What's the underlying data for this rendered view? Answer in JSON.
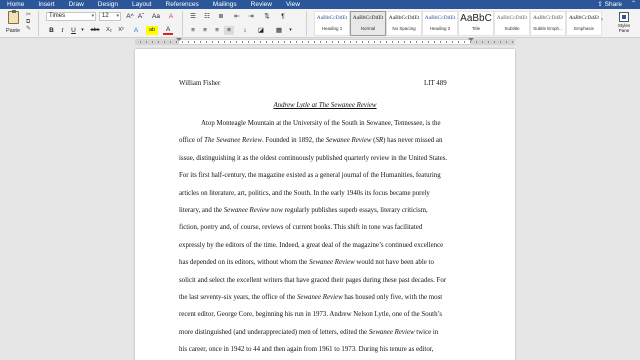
{
  "menu": {
    "tabs": [
      "Home",
      "Insert",
      "Draw",
      "Design",
      "Layout",
      "References",
      "Mailings",
      "Review",
      "View"
    ],
    "active_tab": "Home",
    "share_label": "Share",
    "caret_icon": "chevron-up-icon"
  },
  "ribbon": {
    "paste_label": "Paste",
    "font_name": "Times",
    "font_size": "12",
    "grow_font": "A^",
    "shrink_font": "Aˇ",
    "change_case": "Aa",
    "clear_format": "A",
    "bold": "B",
    "italic": "I",
    "underline": "U",
    "strike": "abc",
    "subscript": "X₂",
    "superscript": "X²",
    "text_effects": "A",
    "highlight": "ab",
    "font_color": "A",
    "pilcrow": "¶",
    "styles": [
      {
        "sample": "AaBbCcDdEt",
        "name": "Heading 1"
      },
      {
        "sample": "AaBbCcDdEt",
        "name": "Normal"
      },
      {
        "sample": "AaBbCcDdEt",
        "name": "No Spacing"
      },
      {
        "sample": "AaBbCcDdEt",
        "name": "Heading 2"
      },
      {
        "sample": "AaBbC",
        "name": "Title"
      },
      {
        "sample": "AaBbCcDdEt",
        "name": "Subtitle"
      },
      {
        "sample": "AaBbCcDdEt",
        "name": "Subtle Emph..."
      },
      {
        "sample": "AaBbCcDdEt",
        "name": "Emphasis"
      }
    ],
    "selected_style": "Normal",
    "styles_pane_label": "Styles\nPane",
    "colors": {
      "accent": "#2b579a",
      "highlight_color": "#ffff00",
      "font_color": "#e02020"
    }
  },
  "document": {
    "header_left": "William Fisher",
    "header_right": "LIT 489",
    "title": "Andrew Lytle at The Sewanee Review",
    "lines": [
      [
        {
          "t": "Atop Monteagle Mountain at the University of the South in Sewanee, Tennessee, is the"
        }
      ],
      [
        {
          "t": "office of "
        },
        {
          "t": "The Sewanee Review",
          "i": true
        },
        {
          "t": ". Founded in 1892, the "
        },
        {
          "t": "Sewanee Review",
          "i": true
        },
        {
          "t": " ("
        },
        {
          "t": "SR",
          "i": true
        },
        {
          "t": ") has never missed an"
        }
      ],
      [
        {
          "t": "issue, distinguishing it as the oldest continuously published quarterly review in the United States."
        }
      ],
      [
        {
          "t": "For its first half-century, the magazine existed as a general journal of the Humanities, featuring"
        }
      ],
      [
        {
          "t": "articles on literature, art, politics, and the South. In the early 1940s its focus became purely"
        }
      ],
      [
        {
          "t": "literary, and the "
        },
        {
          "t": "Sewanee Review",
          "i": true
        },
        {
          "t": " now regularly publishes superb essays, literary criticism,"
        }
      ],
      [
        {
          "t": "fiction, poetry and, of course, reviews of current books. This shift in tone was facilitated"
        }
      ],
      [
        {
          "t": "expressly by the editors of the time. Indeed, a great deal of the magazine’s continued excellence"
        }
      ],
      [
        {
          "t": "has depended on its editors, without whom the "
        },
        {
          "t": "Sewanee Review",
          "i": true
        },
        {
          "t": " would not have been able to"
        }
      ],
      [
        {
          "t": "solicit and select the excellent writers that have graced their pages during these past decades. For"
        }
      ],
      [
        {
          "t": "the last seventy-six years, the office of the "
        },
        {
          "t": "Sewanee Review",
          "i": true
        },
        {
          "t": " has housed only five, with the most"
        }
      ],
      [
        {
          "t": "recent editor, George Core, beginning his run in 1973. Andrew Nelson Lytle, one of the South’s"
        }
      ],
      [
        {
          "t": "more distinguished (and underappreciated) men of letters, edited the "
        },
        {
          "t": "Sewanee Review",
          "i": true
        },
        {
          "t": " twice in"
        }
      ],
      [
        {
          "t": "his career, once in 1942 to 44 and then again from 1961 to 1973. During his tenure as editor,"
        }
      ]
    ]
  }
}
